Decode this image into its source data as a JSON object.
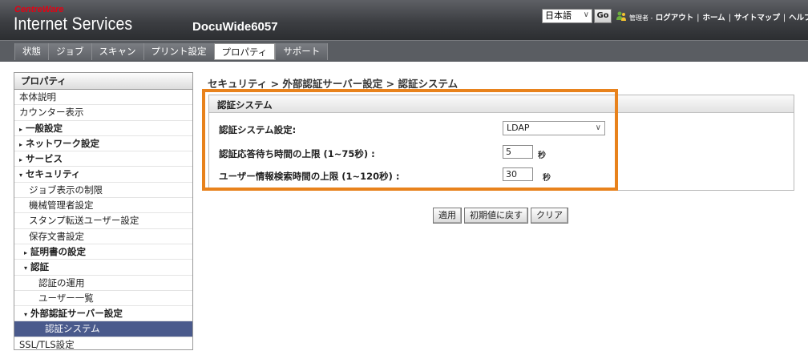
{
  "header": {
    "brand_small": "CentreWare",
    "brand_big": "Internet Services",
    "device_name": "DocuWide6057",
    "language": "日本語",
    "go_label": "Go",
    "admin_label": "管理者 -",
    "links": [
      "ログアウト",
      "ホーム",
      "サイトマップ",
      "ヘルプ"
    ]
  },
  "nav": {
    "tabs": [
      "状態",
      "ジョブ",
      "スキャン",
      "プリント設定",
      "プロパティ",
      "サポート"
    ],
    "active_index": 4
  },
  "sidebar": {
    "title": "プロパティ",
    "items": [
      {
        "label": "本体説明"
      },
      {
        "label": "カウンター表示"
      },
      {
        "label": "一般設定",
        "marker": "▸"
      },
      {
        "label": "ネットワーク設定",
        "marker": "▸"
      },
      {
        "label": "サービス",
        "marker": "▸"
      },
      {
        "label": "セキュリティ",
        "marker": "▾"
      },
      {
        "label": "ジョブ表示の制限"
      },
      {
        "label": "機械管理者設定"
      },
      {
        "label": "スタンプ転送ユーザー設定"
      },
      {
        "label": "保存文書設定"
      },
      {
        "label": "証明書の設定",
        "marker": "▸"
      },
      {
        "label": "認証",
        "marker": "▾"
      },
      {
        "label": "認証の運用"
      },
      {
        "label": "ユーザー一覧"
      },
      {
        "label": "外部認証サーバー設定",
        "marker": "▾"
      },
      {
        "label": "認証システム"
      },
      {
        "label": "SSL/TLS設定"
      }
    ]
  },
  "main": {
    "breadcrumb": "セキュリティ > 外部認証サーバー設定 > 認証システム",
    "panel_title": "認証システム",
    "auth_system_label": "認証システム設定:",
    "auth_system_value": "LDAP",
    "timeout_label": "認証応答待ち時間の上限 (1~75秒) :",
    "timeout_value": "5",
    "search_timeout_label": "ユーザー情報検索時間の上限 (1~120秒) :",
    "search_timeout_value": "30",
    "unit": "秒",
    "buttons": {
      "apply": "適用",
      "restore": "初期値に戻す",
      "clear": "クリア"
    }
  },
  "colors": {
    "highlight": "#e8821c",
    "selected": "#4a5a8c",
    "header": "#3c3e42"
  }
}
